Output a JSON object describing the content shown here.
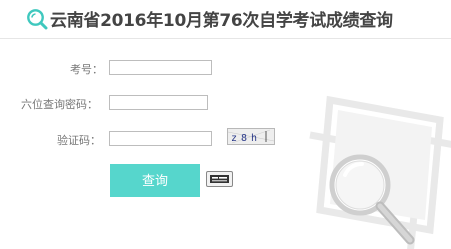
{
  "header": {
    "title": "云南省2016年10月第76次自学考试成绩查询",
    "icon": "search-icon"
  },
  "form": {
    "exam_number": {
      "label": "考号：",
      "value": ""
    },
    "password": {
      "label": "六位查询密码：",
      "value": ""
    },
    "captcha": {
      "label": "验证码：",
      "value": "",
      "image_text": "z8h"
    },
    "submit_label": "查询",
    "extra_icon": "id-card-icon"
  },
  "colors": {
    "accent": "#56d6cc",
    "icon": "#3fc8be",
    "title": "#444444",
    "label": "#777777"
  },
  "decoration": "magnifier-folder-watermark"
}
